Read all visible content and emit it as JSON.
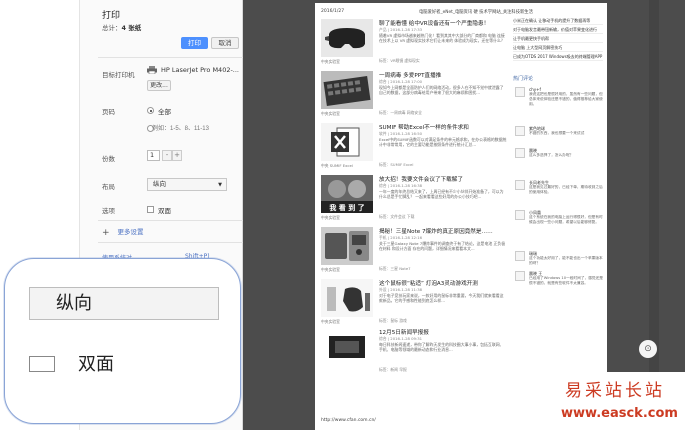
{
  "print_panel": {
    "title": "打印",
    "total_prefix": "总计：",
    "total_value": "4 张纸",
    "print_button": "打印",
    "cancel_button": "取消",
    "destination_label": "目标打印机",
    "printer_name": "HP LaserJet Pro M402-...",
    "change_button": "更改...",
    "pages_label": "页码",
    "pages_all": "全部",
    "pages_range_placeholder": "例如：1-5、8、11-13",
    "copies_label": "份数",
    "copies_value": "1",
    "copies_dec": "-",
    "copies_inc": "+",
    "layout_label": "布局",
    "layout_value": "纵向",
    "options_label": "选项",
    "duplex_label": "双面",
    "more_settings": "更多设置",
    "system_dialog": "使用系统对",
    "system_dialog_shortcut": "Shift+P)"
  },
  "zoom_callout": {
    "layout_value": "纵向",
    "duplex_label": "双面"
  },
  "preview": {
    "date": "2016/1/27",
    "page_title": "电脑爱好者_eNet_电脑资讯 硬 技术学网站_关注科技新生活",
    "footer_url": "http://www.cfan.com.cn/",
    "articles": [
      {
        "title": "聊了能看懂 给中VR设备还有一个严重隐患！",
        "meta": "产品 | 2016-1-28 17:33",
        "excerpt": "随着VR 虚拟市场越来越热门化！看到其其中大部分的厂商都和 电脑 连接在技术上以 VR 虚拟现实技术它们让未来的 体验成为现实，还在等什么？",
        "tags": "标签：VR眼镜 虚拟现实",
        "category": "中央实验室"
      },
      {
        "title": "一周病毒 多爱PPT直播推",
        "meta": "综合 | 2016-1-28 17:00",
        "excerpt": "现如今上网都是全面防护人们的网络活动，很多人在不知不觉中就泄露了自己的数据，这部分病毒给用户带来了很大的麻烦和困扰...",
        "tags": "标签：一周病毒 网络安全",
        "category": "中央实验室"
      },
      {
        "title": "SUMIF 帮助Excel不一样的条件求和",
        "meta": "软件 | 2016-1-28 16:50",
        "excerpt": "Excel中的SUMIF函数可以对满足条件的单元格求和，在办公表格的数据统计中非常常用，它的主要功能是按照条件进行统计汇总...",
        "tags": "标签：SUMIF Excel",
        "category": "中央 SUMIF Excel"
      },
      {
        "title": "放大招！我要文件会议了下载解了",
        "meta": "综合 | 2016-1-28 16:38",
        "excerpt": "一年一度的年终总结又来了，上周已经有不少小伙伴开始准备了，可以为什么总是手忙脚乱？ 一起来看看这些好用的办公小技巧吧...",
        "tags": "标签：文件会议 下载",
        "category": "中央实验室"
      },
      {
        "title": "揭秘！三星Note 7爆炸的真正原因竟然是……",
        "meta": "手机 | 2016-1-28 12:16",
        "excerpt": "关于三星Galaxy Note 7爆炸事件的调查终于有了结论，这是电池 正负极在材料 和设计方面 存在的问题，详细情况来看看本文...",
        "tags": "标签：三星 Note7",
        "category": "中央实验室"
      },
      {
        "title": "这个鼠标很“粘适” 灯泡A3灵动游戏开测",
        "meta": "外设 | 2016-1-28 11:38",
        "excerpt": "对于电子竞技玩家来说，一款好用的鼠标非常重要，今天我们就来看看这款新品，它的手感和性能到底怎么样...",
        "tags": "标签：鼠标 游戏",
        "category": "中央实验室"
      },
      {
        "title": "12月5日新闻早报报",
        "meta": "综合 | 2016-1-28 09:31",
        "excerpt": "每日科技新闻速递，带你了解昨天发生的科技圈大事小事，包括互联网、手机、电脑等领域的最新动态和行业消息...",
        "tags": "标签：新闻 早报",
        "category": ""
      }
    ],
    "sidebar": {
      "links": [
        "小米正在确认 让移动手机的提升了数据再等",
        "对于电脑发言最带钮新输，价值对苹果变化进行",
        "让手机最更快手机帮",
        "让电脑 上大型网页解密技巧",
        "已成为OTDS 2017 Windows吸去的终端管理APP"
      ],
      "comments_heading": "热门评论",
      "comments": [
        {
          "name": "chy+f",
          "text": "我说这把也是很好用的，虽然有一些问题，但总体来说体验还是不错的，值得推荐给大家使用。"
        },
        {
          "name": "紫色地球",
          "text": "不错的东西，我也想要一个来试试"
        },
        {
          "name": "晨晓",
          "text": "这么多选择了，怎么办呢？"
        },
        {
          "name": "长风老先生",
          "text": "这是我见过最好的，已经下单，期待收到之后的使用体验。"
        },
        {
          "name": "小凤凰",
          "text": "这个系统在我的电脑上运行得很好，但是有时候会出现一些小问题，希望以后能够修复。"
        },
        {
          "name": "瑞瑞",
          "text": "这个功能太好用了，能不能也出一个苹果版本的呀？"
        },
        {
          "name": "晨晓 王",
          "text": "已经用了Windows 10一段时间了，感觉还是很不错的，就是有些软件不太兼容。"
        }
      ]
    }
  },
  "watermark": {
    "line1": "易采站长站",
    "line2": "www.easck.com"
  }
}
